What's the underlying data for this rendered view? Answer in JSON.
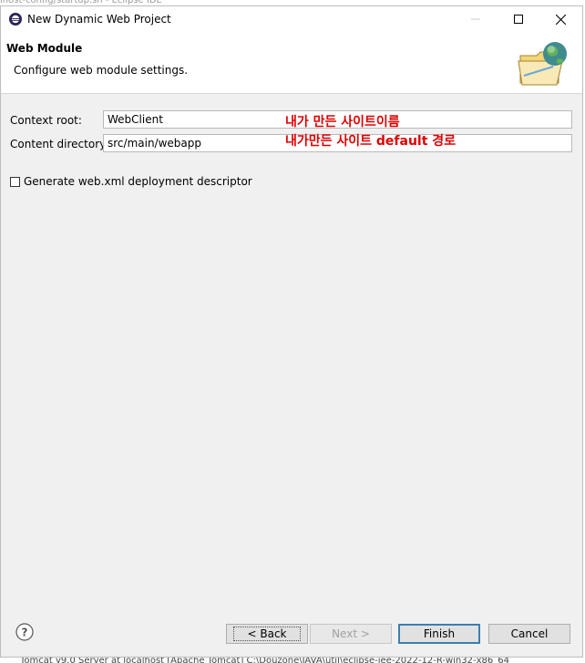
{
  "window": {
    "title": "New Dynamic Web Project",
    "background_title": "lhost-config/startup.sh - Eclipse IDE",
    "status_strip": "Tomcat v9.0 Server at localhost [Apache Tomcat] C:\\Douzone\\JAVA\\util\\eclipse-jee-2022-12-R-win32-x86_64"
  },
  "banner": {
    "title": "Web Module",
    "description": "Configure web module settings."
  },
  "form": {
    "context_root_label": "Context root:",
    "context_root_value": "WebClient",
    "content_dir_label": "Content directory:",
    "content_dir_value": "src/main/webapp",
    "generate_webxml_label": "Generate web.xml deployment descriptor",
    "generate_webxml_checked": false
  },
  "annotations": {
    "context_root_note": "내가 만든 사이트이름",
    "content_dir_note": "내가만든 사이트 default 경로"
  },
  "buttons": {
    "back": "< Back",
    "next": "Next >",
    "finish": "Finish",
    "cancel": "Cancel"
  },
  "colors": {
    "annotation": "#e00000",
    "dialog_bg": "#f0f0f0",
    "default_button_border": "#3c7fb1"
  }
}
